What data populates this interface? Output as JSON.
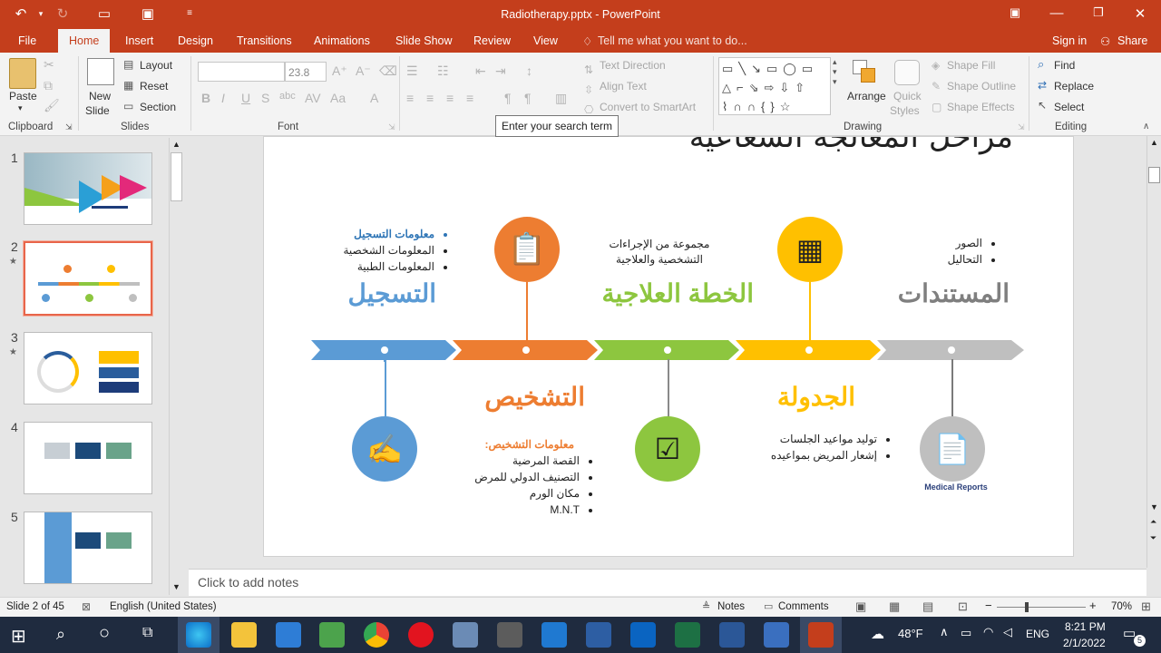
{
  "window": {
    "title": "Radiotherapy.pptx - PowerPoint"
  },
  "tabs": [
    "File",
    "Home",
    "Insert",
    "Design",
    "Transitions",
    "Animations",
    "Slide Show",
    "Review",
    "View"
  ],
  "tell_me": "Tell me what you want to do...",
  "sign_in": "Sign in",
  "share": "Share",
  "ribbon": {
    "paste": "Paste",
    "new_slide": "New",
    "new_slide2": "Slide",
    "layout": "Layout",
    "reset": "Reset",
    "section": "Section",
    "font_name": "",
    "font_size": "23.8",
    "text_direction": "Text Direction",
    "align_text": "Align Text",
    "convert_smartart": "Convert to SmartArt",
    "arrange": "Arrange",
    "quick_styles": "Quick",
    "quick_styles2": "Styles",
    "shape_fill": "Shape Fill",
    "shape_outline": "Shape Outline",
    "shape_effects": "Shape Effects",
    "find": "Find",
    "replace": "Replace",
    "select": "Select",
    "groups": {
      "clipboard": "Clipboard",
      "slides": "Slides",
      "font": "Font",
      "drawing": "Drawing",
      "editing": "Editing"
    },
    "tooltip": "Enter your search term"
  },
  "thumbs": [
    {
      "num": "1",
      "star": ""
    },
    {
      "num": "2",
      "star": "★"
    },
    {
      "num": "3",
      "star": "★"
    },
    {
      "num": "4",
      "star": ""
    },
    {
      "num": "5",
      "star": ""
    }
  ],
  "slide": {
    "title": "مراحل المعالجة الشعاعية",
    "registration": {
      "heading": "التسجيل",
      "items": [
        "معلومات التسجيل",
        "المعلومات الشخصية",
        "المعلومات الطبية"
      ]
    },
    "plan": {
      "heading": "الخطة العلاجية",
      "desc1": "مجموعة من الإجراءات",
      "desc2": "التشخصية والعلاجية"
    },
    "documents": {
      "heading": "المستندات",
      "items": [
        "الصور",
        "التحاليل"
      ]
    },
    "diagnosis": {
      "heading": "التشخيص",
      "subtitle": "معلومات التشخيص:",
      "items": [
        "القصة المرضية",
        "التصنيف الدولي للمرض",
        "مكان الورم",
        "M.N.T"
      ]
    },
    "scheduling": {
      "heading": "الجدولة",
      "items": [
        "توليد مواعيد الجلسات",
        "إشعار المريض بمواعيده"
      ]
    },
    "medical_reports": "Medical Reports"
  },
  "notes_placeholder": "Click to add notes",
  "status": {
    "slide": "Slide 2 of 45",
    "language": "English (United States)",
    "notes": "Notes",
    "comments": "Comments",
    "zoom": "70%"
  },
  "taskbar": {
    "weather": "48°F",
    "lang": "ENG",
    "time": "8:21 PM",
    "date": "2/1/2022",
    "badge": "5"
  },
  "colors": {
    "accent": "#c43e1c",
    "blue": "#5b9bd5",
    "orange": "#ed7d31",
    "green": "#8dc63f",
    "yellow": "#ffc000",
    "gray": "#bfbfbf"
  }
}
